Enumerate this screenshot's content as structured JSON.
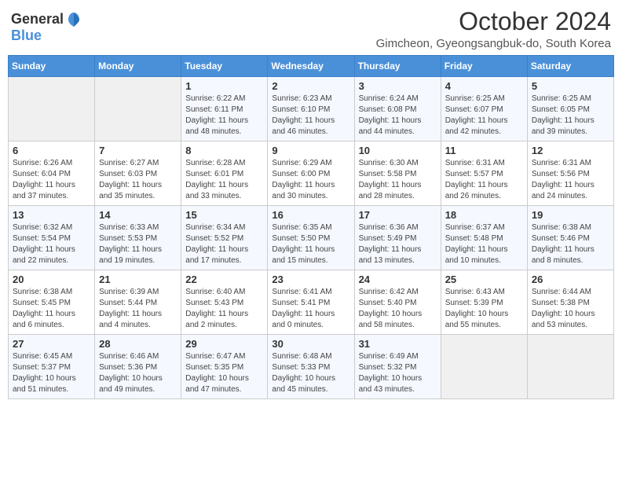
{
  "logo": {
    "text_general": "General",
    "text_blue": "Blue"
  },
  "title": "October 2024",
  "subtitle": "Gimcheon, Gyeongsangbuk-do, South Korea",
  "days_of_week": [
    "Sunday",
    "Monday",
    "Tuesday",
    "Wednesday",
    "Thursday",
    "Friday",
    "Saturday"
  ],
  "weeks": [
    [
      {
        "day": "",
        "info": ""
      },
      {
        "day": "",
        "info": ""
      },
      {
        "day": "1",
        "info": "Sunrise: 6:22 AM\nSunset: 6:11 PM\nDaylight: 11 hours\nand 48 minutes."
      },
      {
        "day": "2",
        "info": "Sunrise: 6:23 AM\nSunset: 6:10 PM\nDaylight: 11 hours\nand 46 minutes."
      },
      {
        "day": "3",
        "info": "Sunrise: 6:24 AM\nSunset: 6:08 PM\nDaylight: 11 hours\nand 44 minutes."
      },
      {
        "day": "4",
        "info": "Sunrise: 6:25 AM\nSunset: 6:07 PM\nDaylight: 11 hours\nand 42 minutes."
      },
      {
        "day": "5",
        "info": "Sunrise: 6:25 AM\nSunset: 6:05 PM\nDaylight: 11 hours\nand 39 minutes."
      }
    ],
    [
      {
        "day": "6",
        "info": "Sunrise: 6:26 AM\nSunset: 6:04 PM\nDaylight: 11 hours\nand 37 minutes."
      },
      {
        "day": "7",
        "info": "Sunrise: 6:27 AM\nSunset: 6:03 PM\nDaylight: 11 hours\nand 35 minutes."
      },
      {
        "day": "8",
        "info": "Sunrise: 6:28 AM\nSunset: 6:01 PM\nDaylight: 11 hours\nand 33 minutes."
      },
      {
        "day": "9",
        "info": "Sunrise: 6:29 AM\nSunset: 6:00 PM\nDaylight: 11 hours\nand 30 minutes."
      },
      {
        "day": "10",
        "info": "Sunrise: 6:30 AM\nSunset: 5:58 PM\nDaylight: 11 hours\nand 28 minutes."
      },
      {
        "day": "11",
        "info": "Sunrise: 6:31 AM\nSunset: 5:57 PM\nDaylight: 11 hours\nand 26 minutes."
      },
      {
        "day": "12",
        "info": "Sunrise: 6:31 AM\nSunset: 5:56 PM\nDaylight: 11 hours\nand 24 minutes."
      }
    ],
    [
      {
        "day": "13",
        "info": "Sunrise: 6:32 AM\nSunset: 5:54 PM\nDaylight: 11 hours\nand 22 minutes."
      },
      {
        "day": "14",
        "info": "Sunrise: 6:33 AM\nSunset: 5:53 PM\nDaylight: 11 hours\nand 19 minutes."
      },
      {
        "day": "15",
        "info": "Sunrise: 6:34 AM\nSunset: 5:52 PM\nDaylight: 11 hours\nand 17 minutes."
      },
      {
        "day": "16",
        "info": "Sunrise: 6:35 AM\nSunset: 5:50 PM\nDaylight: 11 hours\nand 15 minutes."
      },
      {
        "day": "17",
        "info": "Sunrise: 6:36 AM\nSunset: 5:49 PM\nDaylight: 11 hours\nand 13 minutes."
      },
      {
        "day": "18",
        "info": "Sunrise: 6:37 AM\nSunset: 5:48 PM\nDaylight: 11 hours\nand 10 minutes."
      },
      {
        "day": "19",
        "info": "Sunrise: 6:38 AM\nSunset: 5:46 PM\nDaylight: 11 hours\nand 8 minutes."
      }
    ],
    [
      {
        "day": "20",
        "info": "Sunrise: 6:38 AM\nSunset: 5:45 PM\nDaylight: 11 hours\nand 6 minutes."
      },
      {
        "day": "21",
        "info": "Sunrise: 6:39 AM\nSunset: 5:44 PM\nDaylight: 11 hours\nand 4 minutes."
      },
      {
        "day": "22",
        "info": "Sunrise: 6:40 AM\nSunset: 5:43 PM\nDaylight: 11 hours\nand 2 minutes."
      },
      {
        "day": "23",
        "info": "Sunrise: 6:41 AM\nSunset: 5:41 PM\nDaylight: 11 hours\nand 0 minutes."
      },
      {
        "day": "24",
        "info": "Sunrise: 6:42 AM\nSunset: 5:40 PM\nDaylight: 10 hours\nand 58 minutes."
      },
      {
        "day": "25",
        "info": "Sunrise: 6:43 AM\nSunset: 5:39 PM\nDaylight: 10 hours\nand 55 minutes."
      },
      {
        "day": "26",
        "info": "Sunrise: 6:44 AM\nSunset: 5:38 PM\nDaylight: 10 hours\nand 53 minutes."
      }
    ],
    [
      {
        "day": "27",
        "info": "Sunrise: 6:45 AM\nSunset: 5:37 PM\nDaylight: 10 hours\nand 51 minutes."
      },
      {
        "day": "28",
        "info": "Sunrise: 6:46 AM\nSunset: 5:36 PM\nDaylight: 10 hours\nand 49 minutes."
      },
      {
        "day": "29",
        "info": "Sunrise: 6:47 AM\nSunset: 5:35 PM\nDaylight: 10 hours\nand 47 minutes."
      },
      {
        "day": "30",
        "info": "Sunrise: 6:48 AM\nSunset: 5:33 PM\nDaylight: 10 hours\nand 45 minutes."
      },
      {
        "day": "31",
        "info": "Sunrise: 6:49 AM\nSunset: 5:32 PM\nDaylight: 10 hours\nand 43 minutes."
      },
      {
        "day": "",
        "info": ""
      },
      {
        "day": "",
        "info": ""
      }
    ]
  ]
}
